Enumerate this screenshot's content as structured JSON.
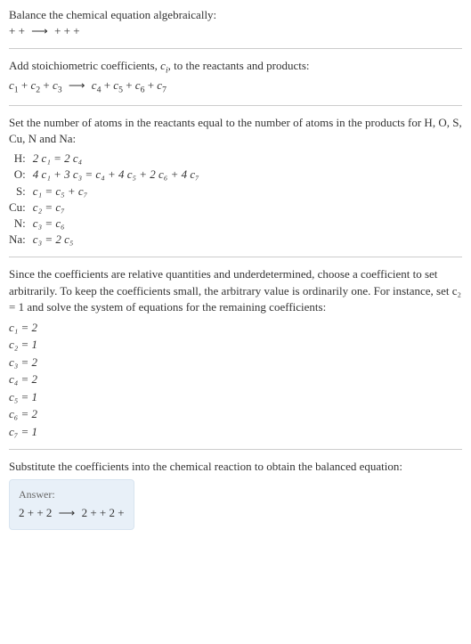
{
  "intro": {
    "line1": "Balance the chemical equation algebraically:",
    "line2_left": " +  + ",
    "line2_right": " +  +  + "
  },
  "step1": {
    "text": "Add stoichiometric coefficients, ",
    "ci": "c",
    "ci_sub": "i",
    "text2": ", to the reactants and products:"
  },
  "step1_eq": {
    "c1": "c",
    "s1": "1",
    "c2": "c",
    "s2": "2",
    "c3": "c",
    "s3": "3",
    "c4": "c",
    "s4": "4",
    "c5": "c",
    "s5": "5",
    "c6": "c",
    "s6": "6",
    "c7": "c",
    "s7": "7"
  },
  "step2": {
    "text": "Set the number of atoms in the reactants equal to the number of atoms in the products for H, O, S, Cu, N and Na:"
  },
  "atoms": {
    "H": {
      "label": "H:",
      "eq": "2 c₁ = 2 c₄"
    },
    "O": {
      "label": "O:",
      "eq": "4 c₁ + 3 c₃ = c₄ + 4 c₅ + 2 c₆ + 4 c₇"
    },
    "S": {
      "label": "S:",
      "eq": "c₁ = c₅ + c₇"
    },
    "Cu": {
      "label": "Cu:",
      "eq": "c₂ = c₇"
    },
    "N": {
      "label": "N:",
      "eq": "c₃ = c₆"
    },
    "Na": {
      "label": "Na:",
      "eq": "c₃ = 2 c₅"
    }
  },
  "step3": {
    "text": "Since the coefficients are relative quantities and underdetermined, choose a coefficient to set arbitrarily. To keep the coefficients small, the arbitrary value is ordinarily one. For instance, set c₂ = 1 and solve the system of equations for the remaining coefficients:"
  },
  "coefs": {
    "c1": "c₁ = 2",
    "c2": "c₂ = 1",
    "c3": "c₃ = 2",
    "c4": "c₄ = 2",
    "c5": "c₅ = 1",
    "c6": "c₆ = 2",
    "c7": "c₇ = 1"
  },
  "step4": {
    "text": "Substitute the coefficients into the chemical reaction to obtain the balanced equation:"
  },
  "answer": {
    "label": "Answer:",
    "left": "2  +  + 2 ",
    "right": "2  +  + 2  + "
  },
  "arrow": "⟶",
  "plus": " + "
}
